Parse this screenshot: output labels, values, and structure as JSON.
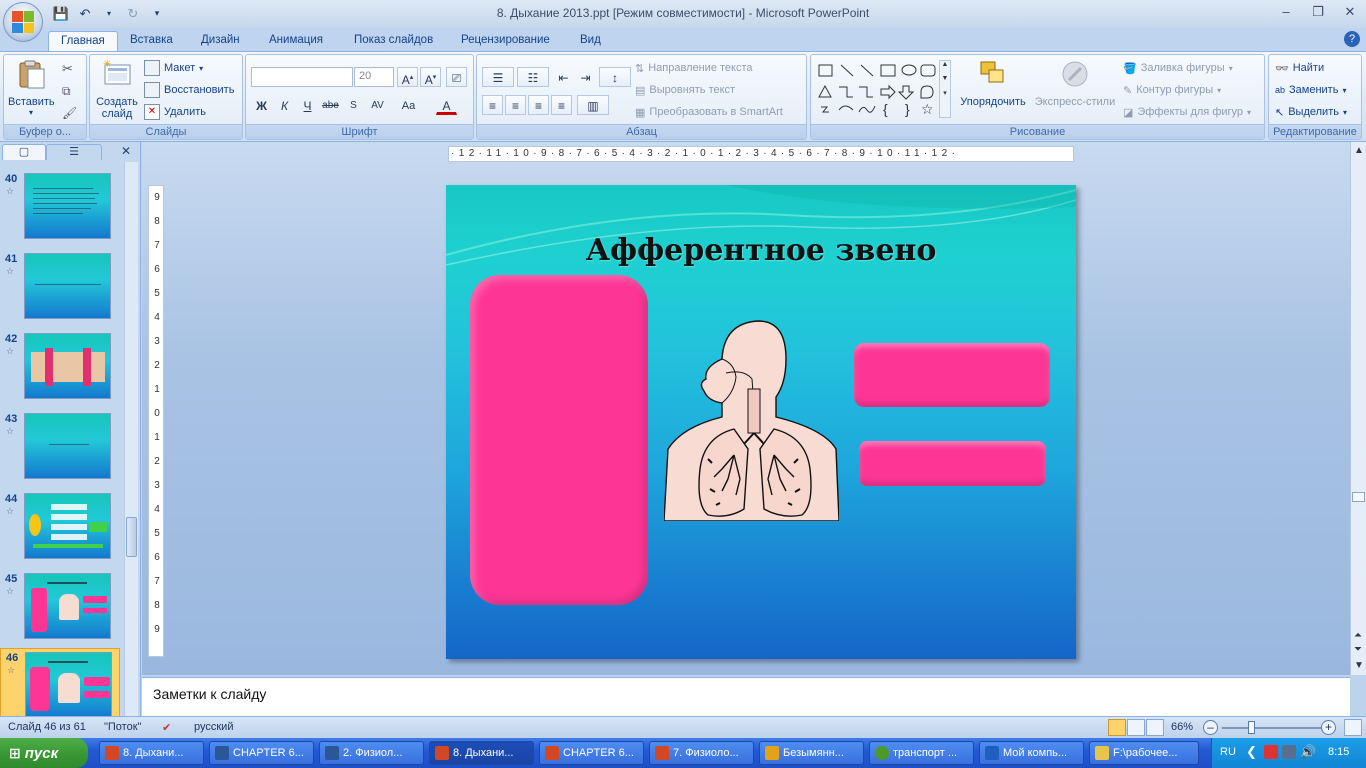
{
  "window": {
    "title": "8. Дыхание 2013.ppt [Режим совместимости] - Microsoft PowerPoint",
    "controls": [
      "–",
      "❐",
      "✕"
    ]
  },
  "ribbon_tabs": [
    "Главная",
    "Вставка",
    "Дизайн",
    "Анимация",
    "Показ слайдов",
    "Рецензирование",
    "Вид"
  ],
  "ribbon": {
    "clipboard": {
      "label": "Буфер о...",
      "paste": "Вставить"
    },
    "slides": {
      "label": "Слайды",
      "new_slide": "Создать слайд",
      "layout": "Макет",
      "reset": "Восстановить",
      "delete": "Удалить"
    },
    "font": {
      "label": "Шрифт",
      "font_name": "",
      "font_size": "20"
    },
    "paragraph": {
      "label": "Абзац",
      "text_direction": "Направление текста",
      "align_text": "Выровнять текст",
      "smartart": "Преобразовать в SmartArt"
    },
    "drawing": {
      "label": "Рисование",
      "arrange": "Упорядочить",
      "quick_styles": "Экспресс-стили",
      "fill": "Заливка фигуры",
      "outline": "Контур фигуры",
      "effects": "Эффекты для фигур"
    },
    "editing": {
      "label": "Редактирование",
      "find": "Найти",
      "replace": "Заменить",
      "select": "Выделить"
    }
  },
  "slides_pane": {
    "thumbs": [
      {
        "num": "40"
      },
      {
        "num": "41"
      },
      {
        "num": "42"
      },
      {
        "num": "43"
      },
      {
        "num": "44"
      },
      {
        "num": "45"
      },
      {
        "num": "46"
      }
    ],
    "selected": "46"
  },
  "rulers": {
    "horizontal": "·12·11·10·9·8·7·6·5·4·3·2·1·0·1·2·3·4·5·6·7·8·9·10·11·12·",
    "vertical": [
      "9",
      "8",
      "7",
      "6",
      "5",
      "4",
      "3",
      "2",
      "1",
      "0",
      "1",
      "2",
      "3",
      "4",
      "5",
      "6",
      "7",
      "8",
      "9"
    ]
  },
  "slide": {
    "title": "Афферентное звено"
  },
  "notes_placeholder": "Заметки к слайду",
  "status": {
    "slide_info": "Слайд 46 из 61",
    "theme": "\"Поток\"",
    "language": "русский",
    "zoom": "66%"
  },
  "taskbar": {
    "start": "пуск",
    "tasks": [
      {
        "label": "8. Дыхани...",
        "color": "#d24726"
      },
      {
        "label": "CHAPTER 6...",
        "color": "#2b5797"
      },
      {
        "label": "2. Физиол...",
        "color": "#2b5797"
      },
      {
        "label": "8. Дыхани...",
        "color": "#d24726"
      },
      {
        "label": "CHAPTER 6...",
        "color": "#d24726"
      },
      {
        "label": "7. Физиоло...",
        "color": "#d24726"
      },
      {
        "label": "Безымянн...",
        "color": "#e3a21a"
      },
      {
        "label": "транспорт ...",
        "color": "#4c9a2a"
      },
      {
        "label": "Мой компь...",
        "color": "#1e5fbf"
      },
      {
        "label": "F:\\рабочее...",
        "color": "#e8c44a"
      }
    ],
    "active_index": 3,
    "lang": "RU",
    "clock": "8:15"
  },
  "colors": {
    "slide_pink": "#fd3696",
    "slide_teal": "#17c8c4",
    "slide_blue": "#1565c9",
    "ribbon_text": "#15428b"
  }
}
